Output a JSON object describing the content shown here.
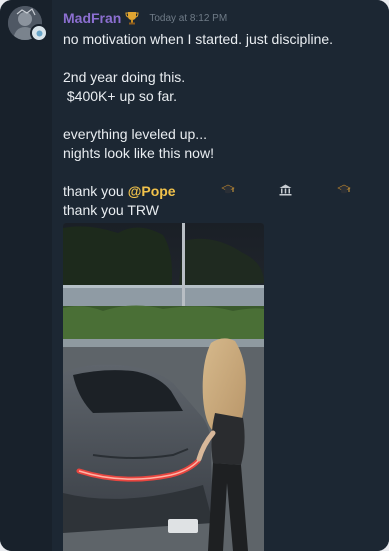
{
  "message": {
    "username": "MadFran",
    "timestamp": "Today at 8:12 PM",
    "lines": [
      "no motivation when I started. just discipline.",
      "",
      "2nd year doing this.",
      " $400K+ up so far.",
      "",
      "everything leveled up...",
      "nights look like this now!",
      ""
    ],
    "thanks_prefix": "thank you",
    "mention": "@Pope",
    "thanks_trw": "thank you TRW",
    "icons": [
      "trophy-icon",
      "graduation-cap-icon",
      "bank-icon",
      "graduation-cap-icon",
      "lightning-icon",
      "verified-badge-icon",
      "white-heart-icon"
    ]
  },
  "colors": {
    "username": "#8c6fd1",
    "mention": "#f1c24b",
    "text": "#e9edf1",
    "timestamp": "#6f7b87",
    "background": "#1c2733"
  },
  "attachment": {
    "type": "photo",
    "subject": "woman standing beside a grey sports car at night"
  }
}
